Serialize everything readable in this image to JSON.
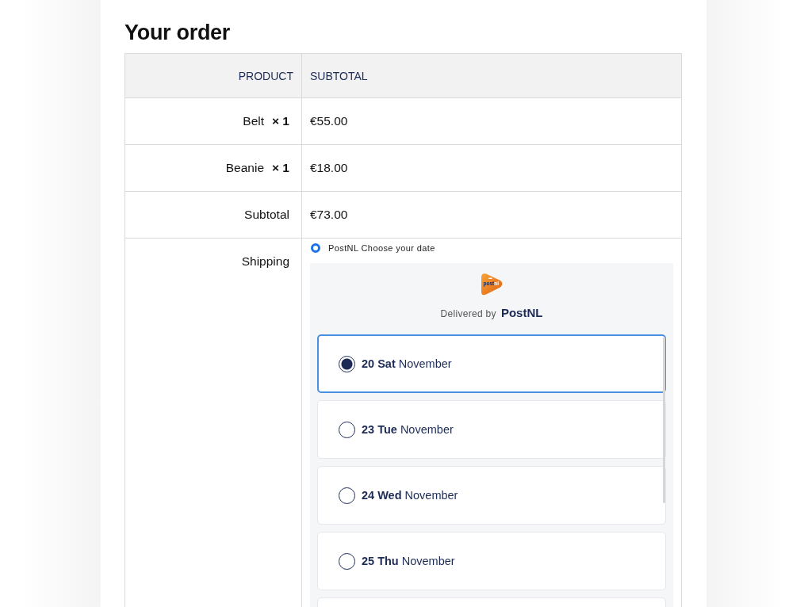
{
  "title": "Your order",
  "table": {
    "columns": [
      "PRODUCT",
      "SUBTOTAL"
    ],
    "rows": [
      {
        "product": "Belt",
        "quantity": "× 1",
        "subtotal": "€55.00"
      },
      {
        "product": "Beanie",
        "quantity": "× 1",
        "subtotal": "€18.00"
      }
    ],
    "subtotal": {
      "label": "Subtotal",
      "value": "€73.00"
    },
    "shipping": {
      "label": "Shipping",
      "method": {
        "label": "PostNL Choose your date",
        "selected": true
      },
      "carrier": {
        "logo_text": [
          "post",
          "nl"
        ],
        "delivered_by": "Delivered by",
        "name": "PostNL"
      },
      "dates": [
        {
          "day": "20 Sat",
          "month": "November",
          "selected": true
        },
        {
          "day": "23 Tue",
          "month": "November",
          "selected": false
        },
        {
          "day": "24 Wed",
          "month": "November",
          "selected": false
        },
        {
          "day": "25 Thu",
          "month": "November",
          "selected": false
        }
      ]
    }
  }
}
